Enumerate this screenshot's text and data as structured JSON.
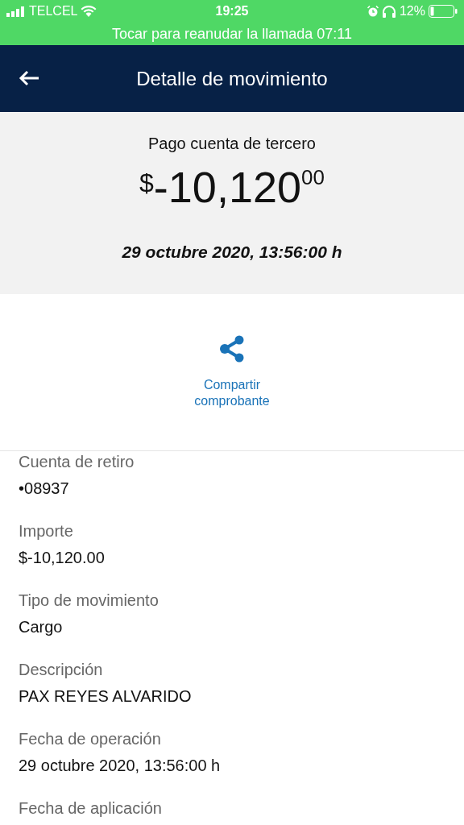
{
  "status_bar": {
    "carrier": "TELCEL",
    "time": "19:25",
    "battery": "12%",
    "call_banner": "Tocar para reanudar la llamada 07:11"
  },
  "header": {
    "title": "Detalle de movimiento"
  },
  "summary": {
    "concept": "Pago cuenta de tercero",
    "currency": "$",
    "amount": "-10,120",
    "cents": "00",
    "datetime": "29 octubre 2020, 13:56:00 h"
  },
  "share": {
    "label": "Compartir comprobante"
  },
  "fields": [
    {
      "label": "Cuenta de retiro",
      "value": "•08937"
    },
    {
      "label": "Importe",
      "value": "$-10,120.00"
    },
    {
      "label": "Tipo de movimiento",
      "value": "Cargo"
    },
    {
      "label": "Descripción",
      "value": "PAX REYES ALVARIDO"
    },
    {
      "label": "Fecha de operación",
      "value": "29 octubre 2020, 13:56:00 h"
    },
    {
      "label": "Fecha de aplicación"
    }
  ]
}
